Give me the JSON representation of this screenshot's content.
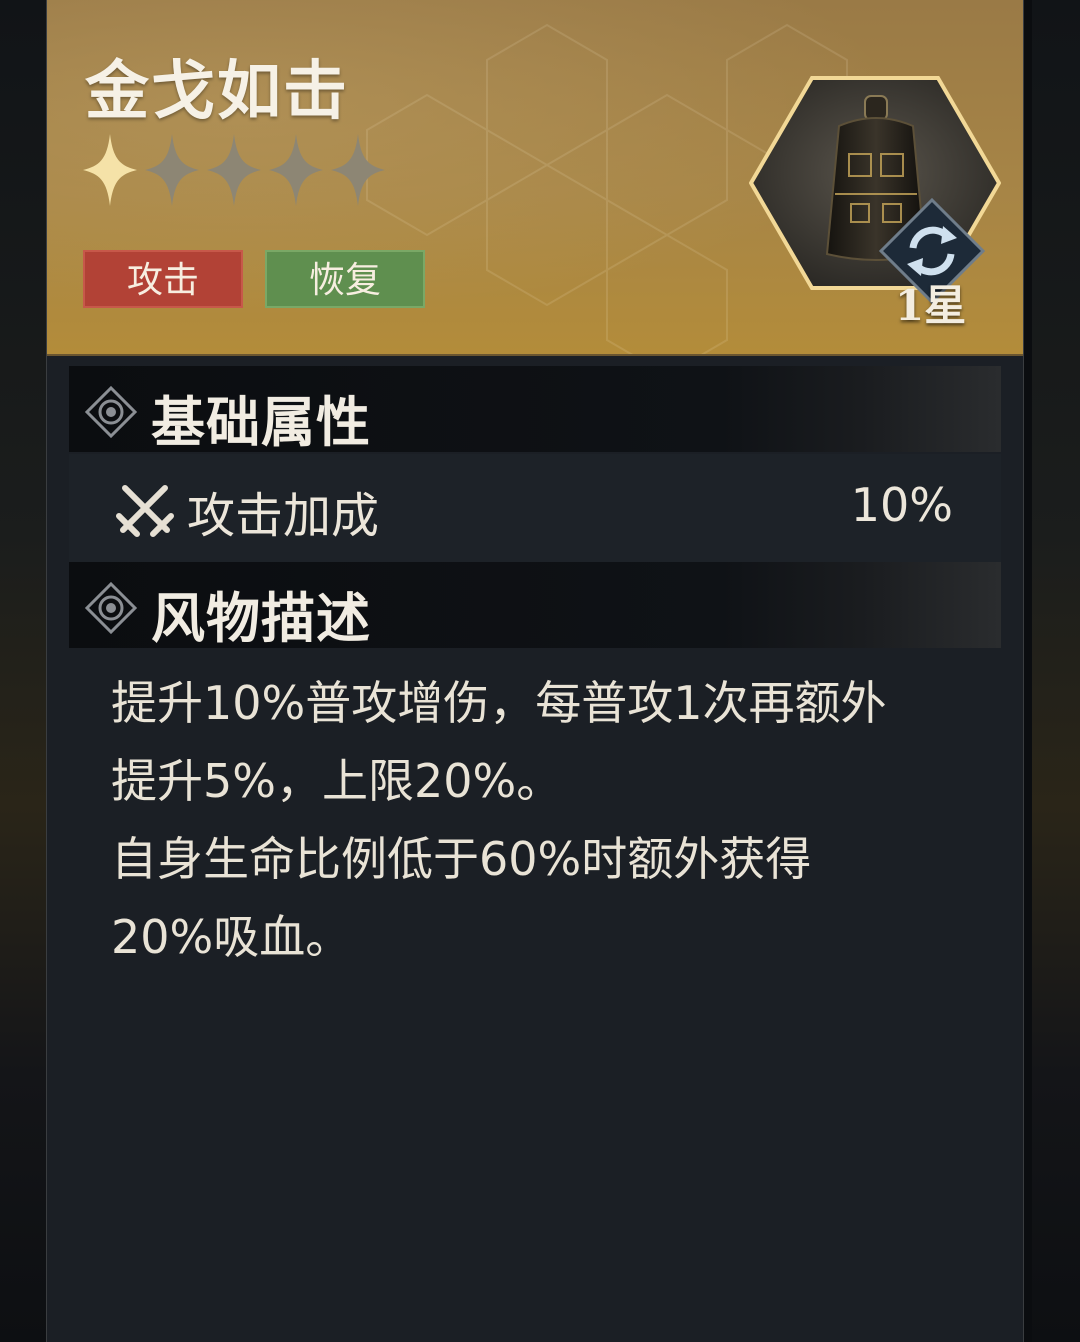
{
  "item": {
    "name": "金戈如击",
    "stars_filled": 1,
    "stars_total": 5,
    "tags": [
      "攻击",
      "恢复"
    ],
    "level_label": "1星",
    "icon": "bronze-bell-icon"
  },
  "sections": {
    "base_title": "基础属性",
    "desc_title": "风物描述"
  },
  "attributes": [
    {
      "name": "攻击加成",
      "value": "10%",
      "icon": "crossed-swords-icon"
    }
  ],
  "description": [
    "提升10%普攻增伤，每普攻1次再额外",
    "提升5%，上限20%。",
    "自身生命比例低于60%时额外获得",
    "20%吸血。"
  ],
  "colors": {
    "header_gold": "#a78546",
    "tag_attack": "#b24236",
    "tag_recover": "#5f8f4f",
    "panel": "#1b1f25"
  }
}
